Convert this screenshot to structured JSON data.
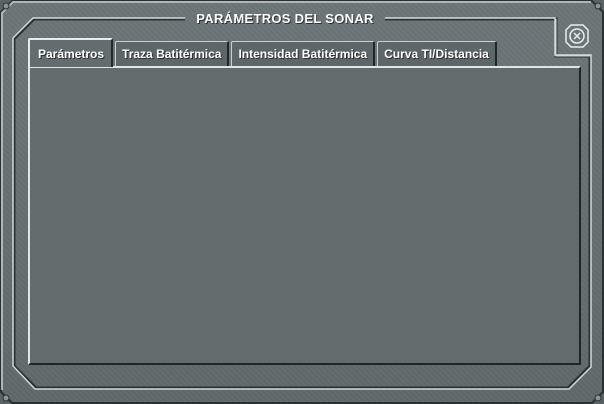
{
  "window": {
    "title": "PARÁMETROS DEL SONAR"
  },
  "tabs": [
    {
      "label": "Parámetros",
      "active": true
    },
    {
      "label": "Traza Batitérmica",
      "active": false
    },
    {
      "label": "Intensidad Batitérmica",
      "active": false
    },
    {
      "label": "Curva TI/Distancia",
      "active": false
    }
  ],
  "icons": {
    "close": "close-icon"
  },
  "colors": {
    "background": "#5f696b",
    "text": "#ffffff",
    "highlight": "#dfe6e8",
    "shadow": "#1f2628"
  }
}
